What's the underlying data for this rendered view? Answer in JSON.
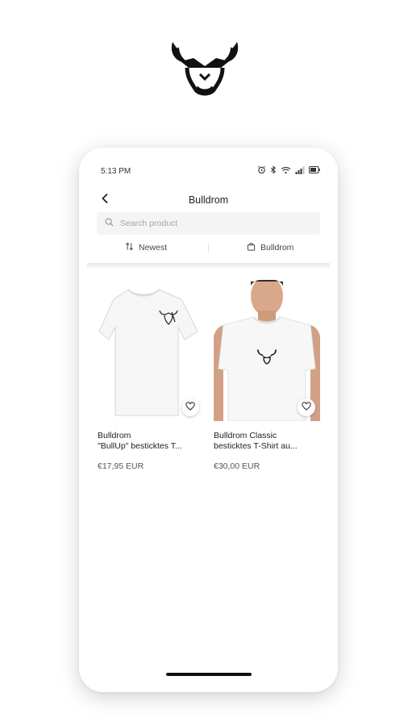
{
  "status_bar": {
    "time": "5:13 PM",
    "icons": [
      "alarm-icon",
      "bluetooth-icon",
      "wifi-icon",
      "signal-icon",
      "battery-icon"
    ]
  },
  "header": {
    "title": "Bulldrom",
    "back_icon": "chevron-left-icon"
  },
  "search": {
    "placeholder": "Search product",
    "value": ""
  },
  "filters": {
    "sort_label": "Newest",
    "brand_label": "Bulldrom"
  },
  "products": [
    {
      "name_line1": "Bulldrom",
      "name_line2": "\"BullUp\" besticktes T...",
      "price": "€17,95 EUR"
    },
    {
      "name_line1": "Bulldrom Classic",
      "name_line2": "besticktes T-Shirt au...",
      "price": "€30,00 EUR"
    }
  ],
  "colors": {
    "accent": "#111111",
    "background": "#ffffff",
    "search_bg": "#f4f4f4"
  }
}
